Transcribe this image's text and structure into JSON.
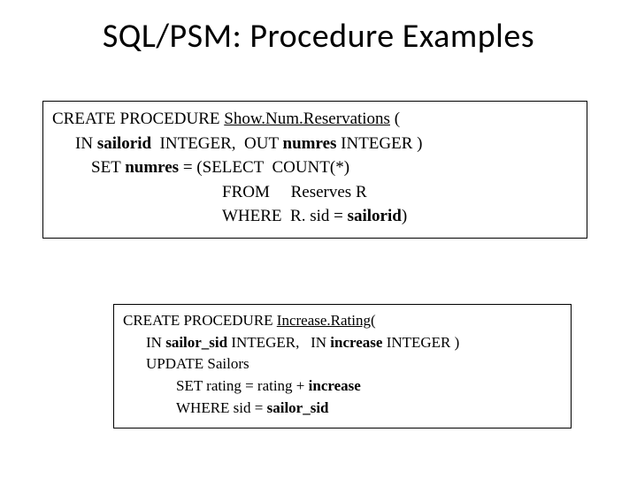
{
  "title": "SQL/PSM: Procedure Examples",
  "box1": {
    "l1a": "CREATE PROCEDURE ",
    "l1b": "Show.Num.Reservations",
    "l1c": " (",
    "l2a": "IN ",
    "l2b": "sailorid",
    "l2c": "  INTEGER,  OUT ",
    "l2d": "numres",
    "l2e": " INTEGER )",
    "l3a": "SET ",
    "l3b": "numres",
    "l3c": " = (SELECT  COUNT(*)",
    "l4": "FROM     Reserves R",
    "l5a": "WHERE  R. sid = ",
    "l5b": "sailorid",
    "l5c": ")"
  },
  "box2": {
    "l1a": "CREATE PROCEDURE ",
    "l1b": "Increase.Rating",
    "l1c": "(",
    "l2a": "IN ",
    "l2b": "sailor_sid",
    "l2c": " INTEGER,   IN ",
    "l2d": "increase",
    "l2e": " INTEGER )",
    "l3": "UPDATE Sailors",
    "l4a": "SET rating = rating + ",
    "l4b": "increase",
    "l5a": "WHERE sid = ",
    "l5b": "sailor_sid"
  }
}
